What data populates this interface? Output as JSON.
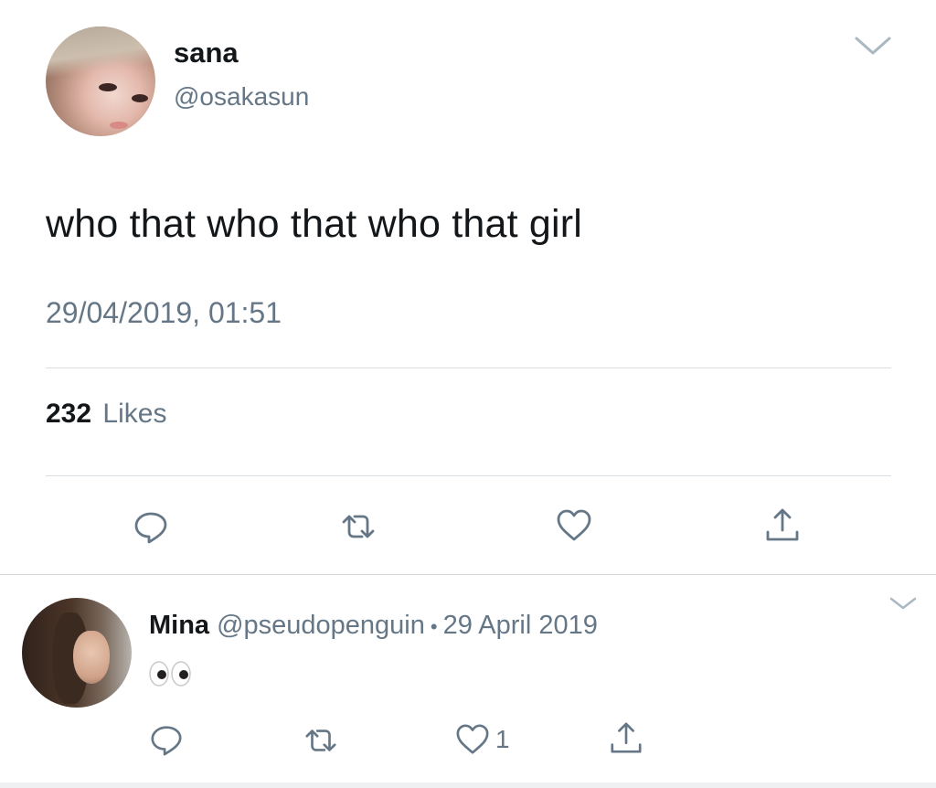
{
  "tweet": {
    "display_name": "sana",
    "handle": "@osakasun",
    "text": "who that who that who that girl",
    "timestamp": "29/04/2019, 01:51",
    "likes_count": "232",
    "likes_label": "Likes",
    "icons": [
      "chevron-down-icon",
      "reply-icon",
      "retweet-icon",
      "heart-icon",
      "share-icon"
    ]
  },
  "reply": {
    "display_name": "Mina",
    "handle": "@pseudopenguin",
    "separator": "•",
    "date": "29 April 2019",
    "text_emoji": "eyes-emoji",
    "like_count": "1",
    "icons": [
      "chevron-down-icon",
      "reply-icon",
      "retweet-icon",
      "heart-icon",
      "share-icon"
    ]
  },
  "colors": {
    "primary_text": "#14171a",
    "secondary_text": "#657786",
    "icon": "#657786",
    "divider": "#d9dee2",
    "background": "#ffffff"
  }
}
